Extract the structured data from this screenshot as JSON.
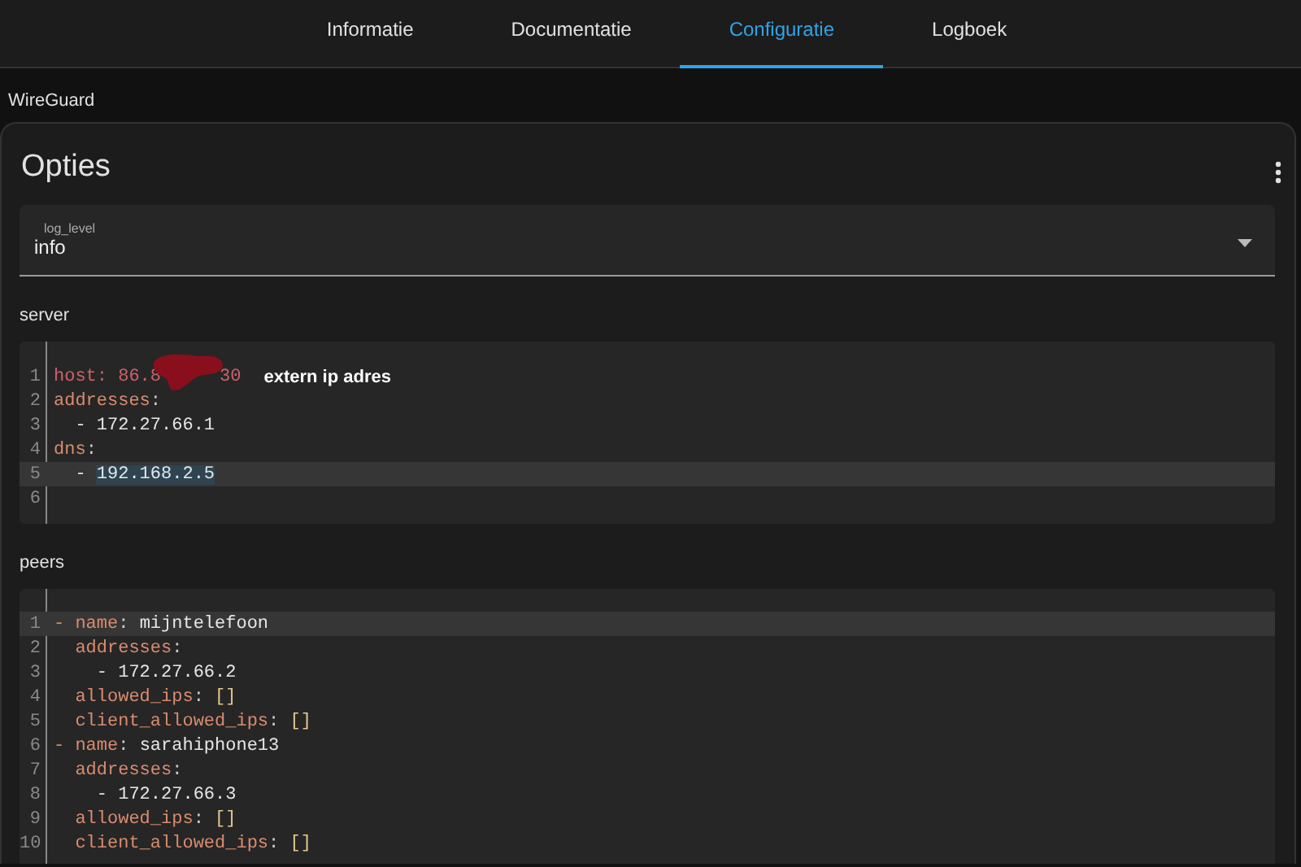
{
  "tabs": [
    {
      "label": "Informatie",
      "selected": false
    },
    {
      "label": "Documentatie",
      "selected": false
    },
    {
      "label": "Configuratie",
      "selected": true
    },
    {
      "label": "Logboek",
      "selected": false
    }
  ],
  "app_title": "WireGuard",
  "card": {
    "title": "Opties",
    "log_level": {
      "label": "log_level",
      "value": "info"
    },
    "sections": [
      {
        "label": "server",
        "lines": [
          {
            "number": "1",
            "active": false,
            "tokens": [
              {
                "kind": "red",
                "text": "host: 86.8"
              },
              {
                "kind": "redacted"
              },
              {
                "kind": "red",
                "text": "30"
              }
            ],
            "note": "extern ip adres"
          },
          {
            "number": "2",
            "active": false,
            "tokens": [
              {
                "kind": "key",
                "text": "addresses"
              },
              {
                "kind": "punct",
                "text": ":"
              }
            ]
          },
          {
            "number": "3",
            "active": false,
            "tokens": [
              {
                "kind": "plain",
                "text": "  - 172.27.66.1"
              }
            ]
          },
          {
            "number": "4",
            "active": false,
            "tokens": [
              {
                "kind": "key",
                "text": "dns"
              },
              {
                "kind": "punct",
                "text": ":"
              }
            ]
          },
          {
            "number": "5",
            "active": true,
            "tokens": [
              {
                "kind": "plain",
                "text": "  - "
              },
              {
                "kind": "selected",
                "text": "192.168.2.5"
              }
            ]
          },
          {
            "number": "6",
            "active": false
          }
        ]
      },
      {
        "label": "peers",
        "lines": [
          {
            "number": "1",
            "active": true,
            "tokens": [
              {
                "kind": "key",
                "text": "- name"
              },
              {
                "kind": "punct",
                "text": ": "
              },
              {
                "kind": "plain",
                "text": "mijntelefoon"
              }
            ]
          },
          {
            "number": "2",
            "active": false,
            "tokens": [
              {
                "kind": "key",
                "text": "  addresses"
              },
              {
                "kind": "punct",
                "text": ":"
              }
            ]
          },
          {
            "number": "3",
            "active": false,
            "tokens": [
              {
                "kind": "plain",
                "text": "    - 172.27.66.2"
              }
            ]
          },
          {
            "number": "4",
            "active": false,
            "tokens": [
              {
                "kind": "key",
                "text": "  allowed_ips"
              },
              {
                "kind": "punct",
                "text": ": "
              },
              {
                "kind": "bracket",
                "text": "[]"
              }
            ]
          },
          {
            "number": "5",
            "active": false,
            "tokens": [
              {
                "kind": "key",
                "text": "  client_allowed_ips"
              },
              {
                "kind": "punct",
                "text": ": "
              },
              {
                "kind": "bracket",
                "text": "[]"
              }
            ]
          },
          {
            "number": "6",
            "active": false,
            "tokens": [
              {
                "kind": "key",
                "text": "- name"
              },
              {
                "kind": "punct",
                "text": ": "
              },
              {
                "kind": "plain",
                "text": "sarahiphone13"
              }
            ]
          },
          {
            "number": "7",
            "active": false,
            "tokens": [
              {
                "kind": "key",
                "text": "  addresses"
              },
              {
                "kind": "punct",
                "text": ":"
              }
            ]
          },
          {
            "number": "8",
            "active": false,
            "tokens": [
              {
                "kind": "plain",
                "text": "    - 172.27.66.3"
              }
            ]
          },
          {
            "number": "9",
            "active": false,
            "tokens": [
              {
                "kind": "key",
                "text": "  allowed_ips"
              },
              {
                "kind": "punct",
                "text": ": "
              },
              {
                "kind": "bracket",
                "text": "[]"
              }
            ]
          },
          {
            "number": "10",
            "active": false,
            "tokens": [
              {
                "kind": "key",
                "text": "  client_allowed_ips"
              },
              {
                "kind": "punct",
                "text": ": "
              },
              {
                "kind": "bracket",
                "text": "[]"
              }
            ]
          }
        ]
      }
    ]
  }
}
